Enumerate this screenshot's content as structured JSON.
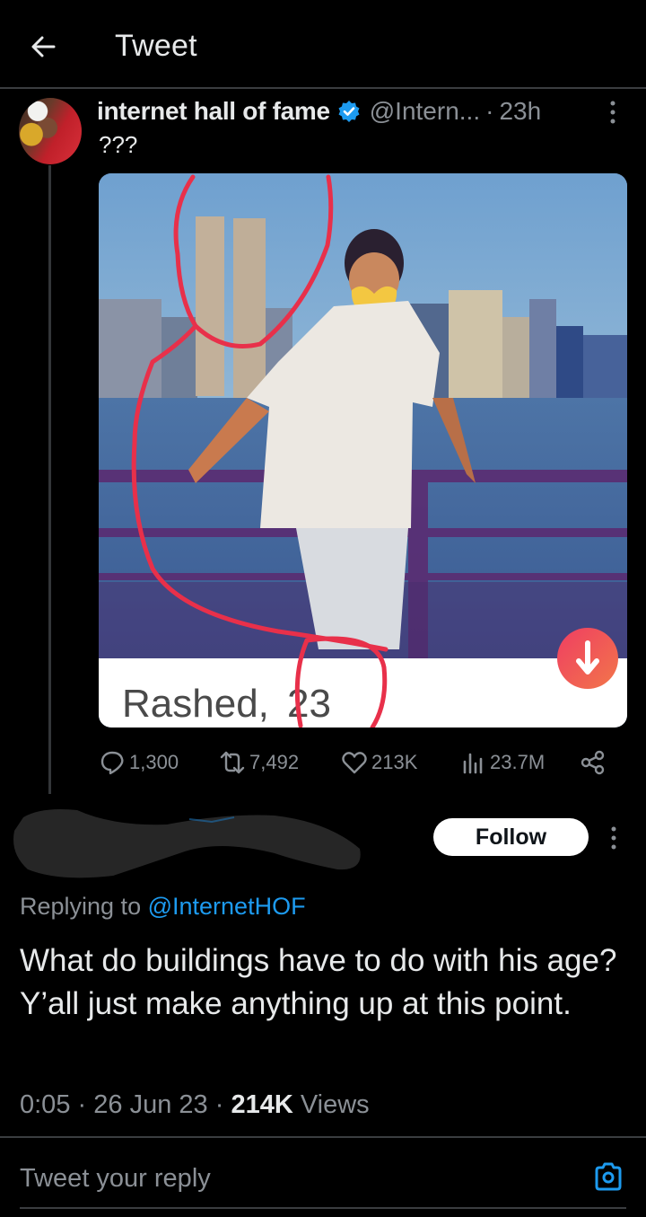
{
  "header": {
    "title": "Tweet",
    "back_icon": "arrow-left-icon"
  },
  "tweet": {
    "author": {
      "display_name": "internet hall of fame",
      "verified": true,
      "handle": "@Intern...",
      "avatar": "avatar-image"
    },
    "separator": "·",
    "time_ago": "23h",
    "text": "???",
    "media": {
      "caption_name": "Rashed,",
      "caption_age": "23",
      "badge_icon": "arrow-down-icon",
      "colors": {
        "sky": "#6f9fcf",
        "water": "#3c5f96",
        "annotation": "#e8304a",
        "caption_bg": "#ffffff",
        "badge": "#ef4b5e"
      }
    },
    "stats": {
      "replies": "1,300",
      "retweets": "7,492",
      "likes": "213K",
      "views": "23.7M"
    }
  },
  "reply": {
    "follow_label": "Follow",
    "replying_prefix": "Replying to",
    "replying_to": "@InternetHOF",
    "text": "What do buildings have to do with his age? Y’all just make anything up at this point.",
    "time": "0:05",
    "separator": "·",
    "date": "26 Jun 23",
    "views_count": "214K",
    "views_label": "Views"
  },
  "composer": {
    "placeholder": "Tweet your reply"
  },
  "colors": {
    "background": "#000000",
    "accent": "#1d9bf0",
    "muted_text": "#8b9096",
    "primary_text": "#e7e9ea",
    "divider": "#3a3d40"
  }
}
